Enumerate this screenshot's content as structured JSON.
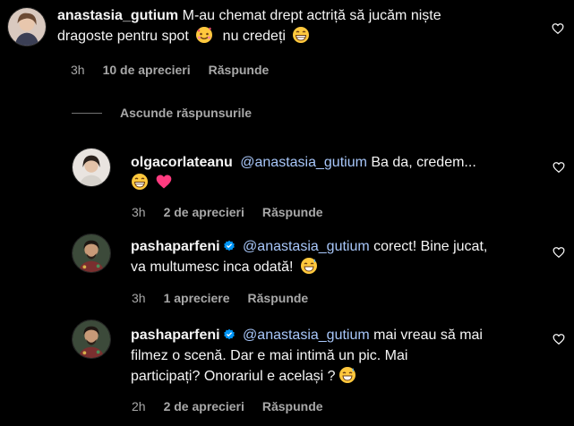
{
  "comments": [
    {
      "username": "anastasia_gutium",
      "verified": false,
      "mention": "",
      "text_line1": "M-au chemat drept actriță să jucăm niște",
      "text_line2_a": "dragoste pentru spot",
      "text_line2_b": "nu credeți",
      "emojis": [
        "smiling-face-with-hearts",
        "grinning-face"
      ],
      "time": "3h",
      "likes": "10 de aprecieri",
      "reply": "Răspunde"
    }
  ],
  "replies_toggle": {
    "label": "Ascunde răspunsurile"
  },
  "replies": [
    {
      "username": "olgacorlateanu",
      "verified": false,
      "mention": "@anastasia_gutium",
      "text_line1": "Ba da, credem...",
      "emojis": [
        "grinning-face",
        "pink-heart"
      ],
      "time": "3h",
      "likes": "2 de aprecieri",
      "reply": "Răspunde"
    },
    {
      "username": "pashaparfeni",
      "verified": true,
      "mention": "@anastasia_gutium",
      "text_line1": "corect! Bine jucat,",
      "text_line2": "va multumesc inca odată!",
      "emojis": [
        "sweat-smile-face"
      ],
      "time": "3h",
      "likes": "1 apreciere",
      "reply": "Răspunde"
    },
    {
      "username": "pashaparfeni",
      "verified": true,
      "mention": "@anastasia_gutium",
      "text_line1": "mai vreau să mai",
      "text_line2": "filmez o scenă. Dar e mai intimă un pic. Mai",
      "text_line3": "participați? Onorariul e același ?",
      "emojis": [
        "sweat-smile-face"
      ],
      "time": "2h",
      "likes": "2 de aprecieri",
      "reply": "Răspunde"
    }
  ],
  "colors": {
    "background": "#000000",
    "text": "#f5f5f5",
    "secondary": "#a8a8a8",
    "mention": "#a8c7fa",
    "verified": "#0095f6",
    "heart": "#ff3b7f"
  }
}
